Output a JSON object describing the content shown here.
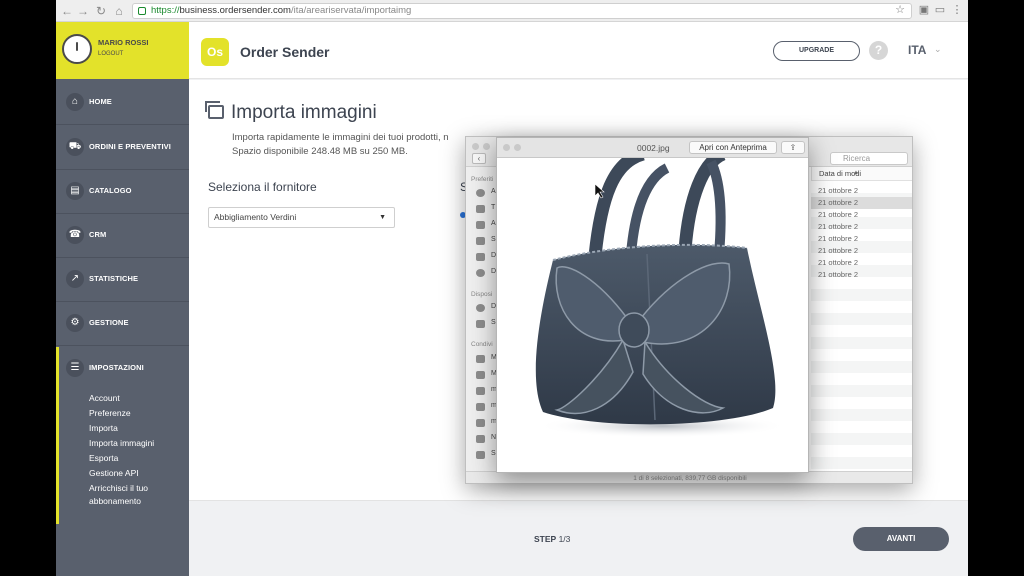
{
  "browser": {
    "url_secure": "https://",
    "url_host": "business.ordersender.com",
    "url_path": "/ita/areariservata/importaimg"
  },
  "user": {
    "name": "MARIO ROSSI",
    "logout": "LOGOUT"
  },
  "sidebar": {
    "items": [
      {
        "label": "HOME",
        "icon": "home-icon"
      },
      {
        "label": "ORDINI E PREVENTIVI",
        "icon": "cart-icon"
      },
      {
        "label": "CATALOGO",
        "icon": "book-icon"
      },
      {
        "label": "CRM",
        "icon": "phone-icon"
      },
      {
        "label": "STATISTICHE",
        "icon": "chart-icon"
      },
      {
        "label": "GESTIONE",
        "icon": "gear-icon"
      },
      {
        "label": "IMPOSTAZIONI",
        "icon": "sliders-icon"
      }
    ],
    "sub_items": [
      "Account",
      "Preferenze",
      "Importa",
      "Importa immagini",
      "Esporta",
      "Gestione API",
      "Arricchisci il tuo",
      "abbonamento"
    ]
  },
  "header": {
    "logo": "Os",
    "brand": "Order Sender",
    "upgrade": "UPGRADE",
    "help": "?",
    "lang": "ITA",
    "lang_chevron": "⌄"
  },
  "main": {
    "title": "Importa immagini",
    "desc1": "Importa rapidamente le immagini dei tuoi prodotti, n",
    "desc2": "Spazio disponibile 248.48 MB su 250 MB.",
    "supplier_label": "Seleziona il fornitore",
    "supplier_value": "Abbigliamento Verdini",
    "second_label": "S"
  },
  "footer": {
    "step_label": "STEP",
    "step_value": "1/3",
    "next": "AVANTI"
  },
  "finder": {
    "search_placeholder": "Ricerca",
    "sidebar_favorites": "Preferiti",
    "sidebar_devices": "Disposi",
    "sidebar_shared": "Condivi",
    "fav_letters": [
      "A",
      "T",
      "A",
      "S",
      "D",
      "D"
    ],
    "device_letters": [
      "D",
      "S"
    ],
    "shared_letters": [
      "M",
      "M",
      "m",
      "m",
      "m",
      "N",
      "S"
    ],
    "date_header": "Data di modi",
    "dates": [
      "21 ottobre 2",
      "21 ottobre 2",
      "21 ottobre 2",
      "21 ottobre 2",
      "21 ottobre 2",
      "21 ottobre 2",
      "21 ottobre 2",
      "21 ottobre 2"
    ],
    "status": "1 di 8 selezionati, 839,77 GB disponibili"
  },
  "preview": {
    "filename": "0002.jpg",
    "open_with": "Apri con Anteprima",
    "image_subject": "denim-handbag-image"
  }
}
